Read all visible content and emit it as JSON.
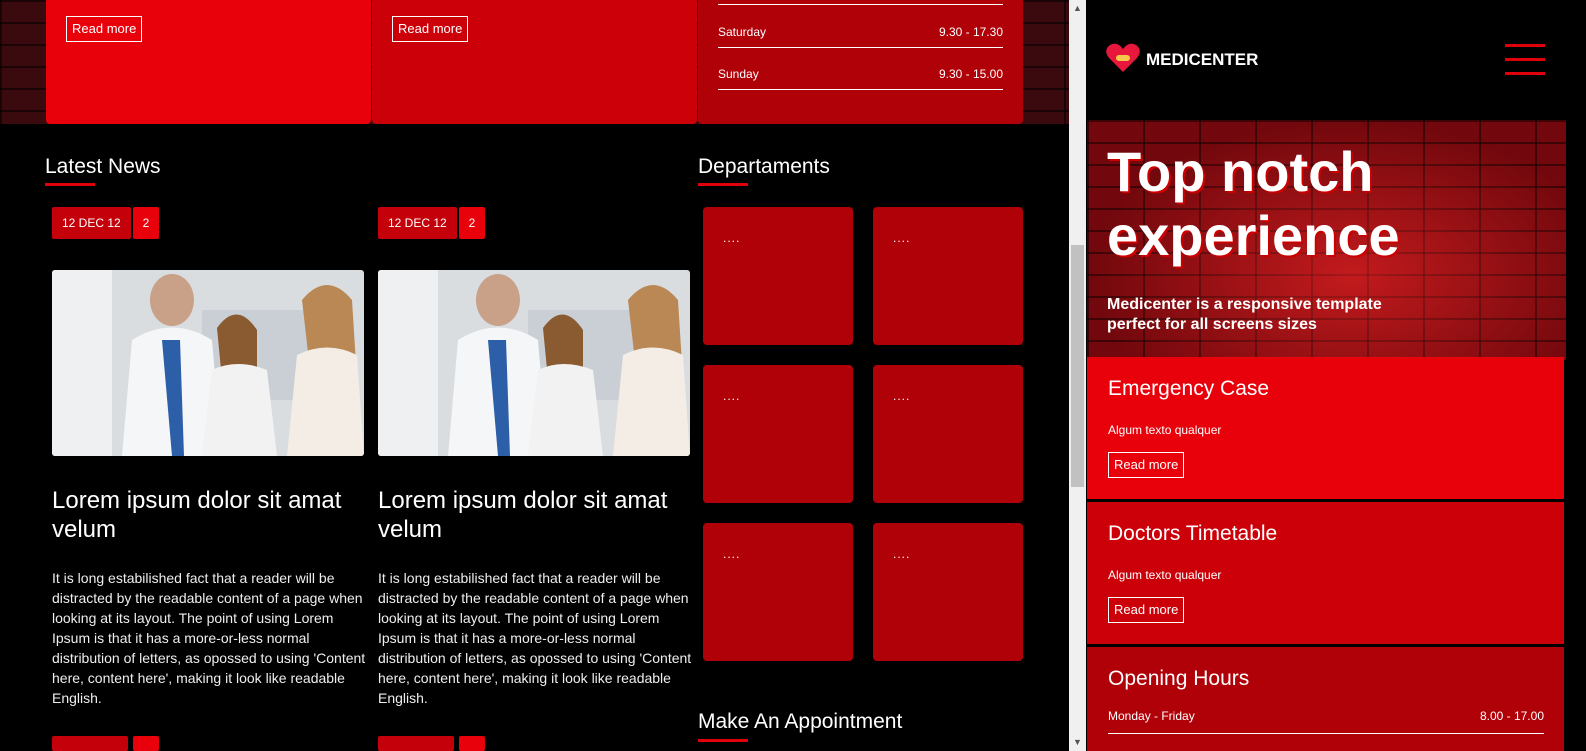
{
  "main": {
    "top_cards": [
      {
        "read_more": "Read more"
      },
      {
        "read_more": "Read more"
      }
    ],
    "hours_top": [
      {
        "day": "Saturday",
        "time": "9.30 - 17.30"
      },
      {
        "day": "Sunday",
        "time": "9.30 - 15.00"
      }
    ],
    "latest_news": {
      "title": "Latest News",
      "items": [
        {
          "date": "12 DEC 12",
          "count": "2",
          "headline": "Lorem ipsum dolor sit amat velum",
          "body": "It is long estabilished fact that a reader will be distracted by the readable content of a page when looking at its layout. The point of using Lorem Ipsum is that it has a more-or-less normal distribution of letters, as opossed to using 'Content here, content here', making it look like readable English."
        },
        {
          "date": "12 DEC 12",
          "count": "2",
          "headline": "Lorem ipsum dolor sit amat velum",
          "body": "It is long estabilished fact that a reader will be distracted by the readable content of a page when looking at its layout. The point of using Lorem Ipsum is that it has a more-or-less normal distribution of letters, as opossed to using 'Content here, content here', making it look like readable English."
        }
      ]
    },
    "departments": {
      "title": "Departaments",
      "items": [
        "....",
        "....",
        "....",
        "....",
        "....",
        "...."
      ]
    },
    "appointment": {
      "title": "Make An Appointment"
    }
  },
  "mobile": {
    "brand": "MEDICENTER",
    "hero": {
      "title": "Top notch experience",
      "subtitle": "Medicenter is a responsive template perfect for all screens sizes"
    },
    "cards": [
      {
        "title": "Emergency Case",
        "text": "Algum texto qualquer",
        "read_more": "Read more"
      },
      {
        "title": "Doctors Timetable",
        "text": "Algum texto qualquer",
        "read_more": "Read more"
      },
      {
        "title": "Opening Hours"
      }
    ],
    "hours": [
      {
        "day": "Monday - Friday",
        "time": "8.00 - 17.00"
      }
    ]
  },
  "colors": {
    "accent": "#e0000b",
    "dark_red": "#b00008",
    "background": "#000000"
  }
}
